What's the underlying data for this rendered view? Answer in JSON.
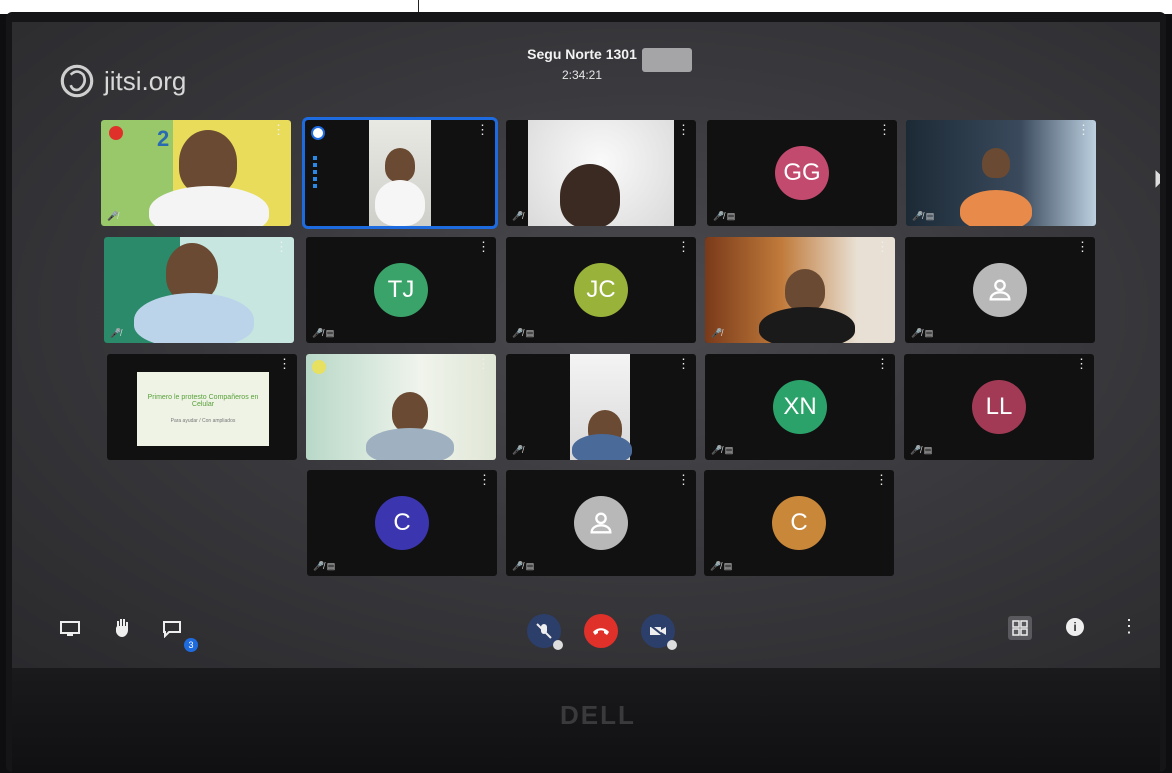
{
  "app": {
    "logo_text": "jitsi.org"
  },
  "room": {
    "name": "Segu Norte 1301",
    "duration": "2:34:21"
  },
  "participants": [
    {
      "initials": "",
      "kind": "video",
      "label": "2"
    },
    {
      "initials": "",
      "kind": "video-active"
    },
    {
      "initials": "",
      "kind": "video"
    },
    {
      "initials": "GG",
      "kind": "avatar",
      "color": "#c24a6e"
    },
    {
      "initials": "",
      "kind": "video"
    },
    {
      "initials": "",
      "kind": "video"
    },
    {
      "initials": "TJ",
      "kind": "avatar",
      "color": "#3aa36a"
    },
    {
      "initials": "JC",
      "kind": "avatar",
      "color": "#98b23a"
    },
    {
      "initials": "",
      "kind": "video"
    },
    {
      "initials": "",
      "kind": "default-avatar"
    },
    {
      "initials": "",
      "kind": "slide",
      "slide_title": "Primero le protesto Compañeros en Celular",
      "slide_sub": "Para ayudar / Con ampliados"
    },
    {
      "initials": "",
      "kind": "video"
    },
    {
      "initials": "",
      "kind": "video"
    },
    {
      "initials": "XN",
      "kind": "avatar",
      "color": "#2aa26a"
    },
    {
      "initials": "LL",
      "kind": "avatar",
      "color": "#a23a55"
    },
    {
      "initials": "C",
      "kind": "avatar",
      "color": "#3b36b0"
    },
    {
      "initials": "",
      "kind": "default-avatar"
    },
    {
      "initials": "C",
      "kind": "avatar",
      "color": "#c9873a"
    }
  ],
  "toolbar": {
    "chat_unread": "3",
    "screen_brand": "DELL"
  },
  "colors": {
    "accent": "#1e6be0",
    "hangup": "#e0302a"
  }
}
